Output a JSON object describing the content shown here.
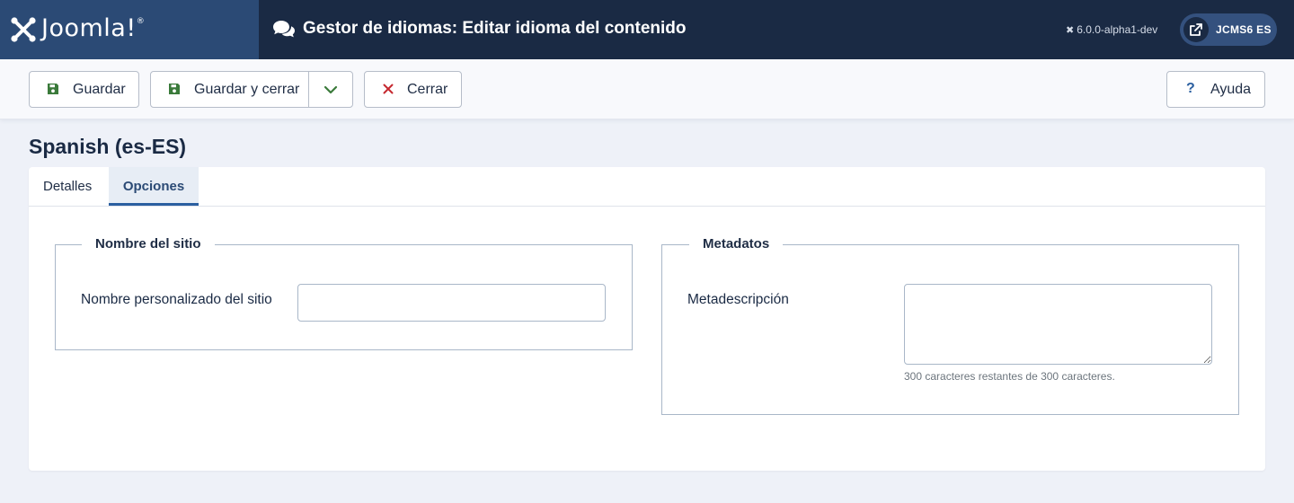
{
  "header": {
    "brand": "Joomla!",
    "title": "Gestor de idiomas: Editar idioma del contenido",
    "version": "6.0.0-alpha1-dev",
    "site_button": "JCMS6 ES"
  },
  "toolbar": {
    "save": "Guardar",
    "save_close": "Guardar y cerrar",
    "close": "Cerrar",
    "help": "Ayuda"
  },
  "page": {
    "language_title": "Spanish (es-ES)"
  },
  "tabs": [
    {
      "label": "Detalles",
      "active": false
    },
    {
      "label": "Opciones",
      "active": true
    }
  ],
  "fieldsets": {
    "site_name": {
      "legend": "Nombre del sitio",
      "label": "Nombre personalizado del sitio",
      "value": ""
    },
    "metadata": {
      "legend": "Metadatos",
      "label": "Metadescripción",
      "value": "",
      "char_counter": "300 caracteres restantes de 300 caracteres."
    }
  },
  "colors": {
    "header_bg": "#1a2a44",
    "logo_bg": "#2b4a75",
    "save_icon": "#3a7a3a",
    "close_icon": "#c5282f",
    "help_icon": "#2b5fa0"
  },
  "icons": {
    "header": "comments-icon",
    "version": "joomla-icon",
    "site_button": "external-link-icon",
    "save": "floppy-disk-icon",
    "dropdown": "chevron-down-icon",
    "close": "x-icon",
    "help": "question-icon"
  }
}
